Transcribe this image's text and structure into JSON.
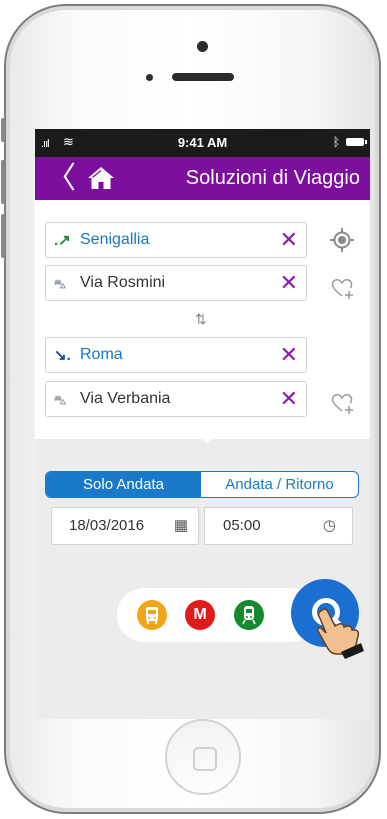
{
  "status_bar": {
    "time": "9:41 AM",
    "signal": ".ııl",
    "wifi": "≋"
  },
  "header": {
    "title": "Soluzioni di Viaggio",
    "back_glyph": "〈"
  },
  "origin": {
    "city": "Senigallia",
    "address": "Via Rosmini"
  },
  "destination": {
    "city": "Roma",
    "address": "Via Verbania"
  },
  "clear_glyph": "✕",
  "trip_type": {
    "one_way": "Solo Andata",
    "round_trip": "Andata / Ritorno",
    "selected": "one_way"
  },
  "date": {
    "value": "18/03/2016"
  },
  "time": {
    "value": "05:00"
  },
  "transport_modes": [
    {
      "name": "bus",
      "letter": "🚌",
      "color": "#f0a51a"
    },
    {
      "name": "metro",
      "letter": "M",
      "color": "#e01b1b"
    },
    {
      "name": "train",
      "letter": "🚆",
      "color": "#158a2e"
    }
  ],
  "colors": {
    "header": "#7d0f9f",
    "accent": "#1a79c9",
    "clear": "#8a1ab5"
  }
}
